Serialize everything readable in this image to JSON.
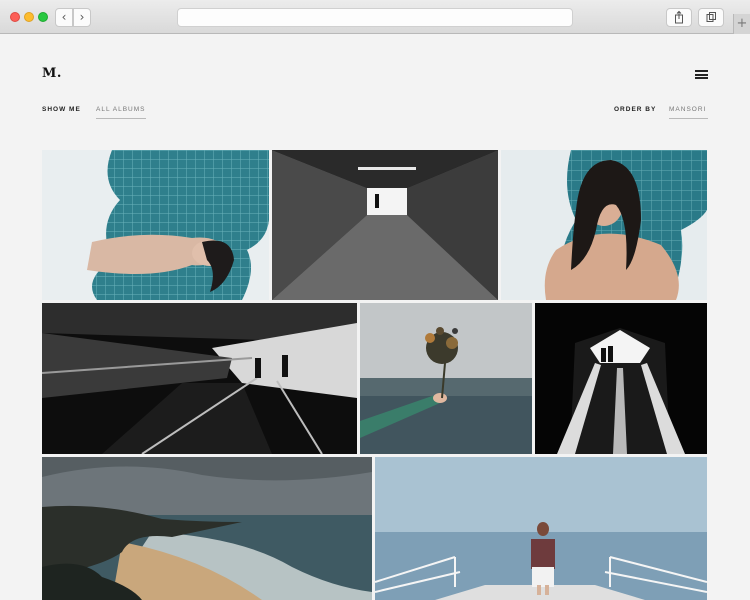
{
  "browser": {
    "back_icon": "chevron-left-icon",
    "forward_icon": "chevron-right-icon",
    "back_glyph": "‹",
    "forward_glyph": "›",
    "share_icon": "share-icon",
    "tabs_icon": "tabs-icon",
    "new_tab_icon": "plus-icon",
    "new_tab_glyph": "+"
  },
  "header": {
    "logo": "M.",
    "menu_icon": "hamburger-menu-icon"
  },
  "filters": {
    "show_label": "SHOW ME",
    "show_value": "ALL ALBUMS",
    "order_label": "ORDER BY",
    "order_value": "MANSORI"
  },
  "gallery": {
    "photos": [
      {
        "subject": "woman floating in pool"
      },
      {
        "subject": "figure at end of tunnel"
      },
      {
        "subject": "woman with wet hair in pool"
      },
      {
        "subject": "escalator silhouettes"
      },
      {
        "subject": "hand holding flowers over sea"
      },
      {
        "subject": "couple in bright tunnel"
      },
      {
        "subject": "rocky coastline"
      },
      {
        "subject": "woman on pier"
      }
    ]
  }
}
